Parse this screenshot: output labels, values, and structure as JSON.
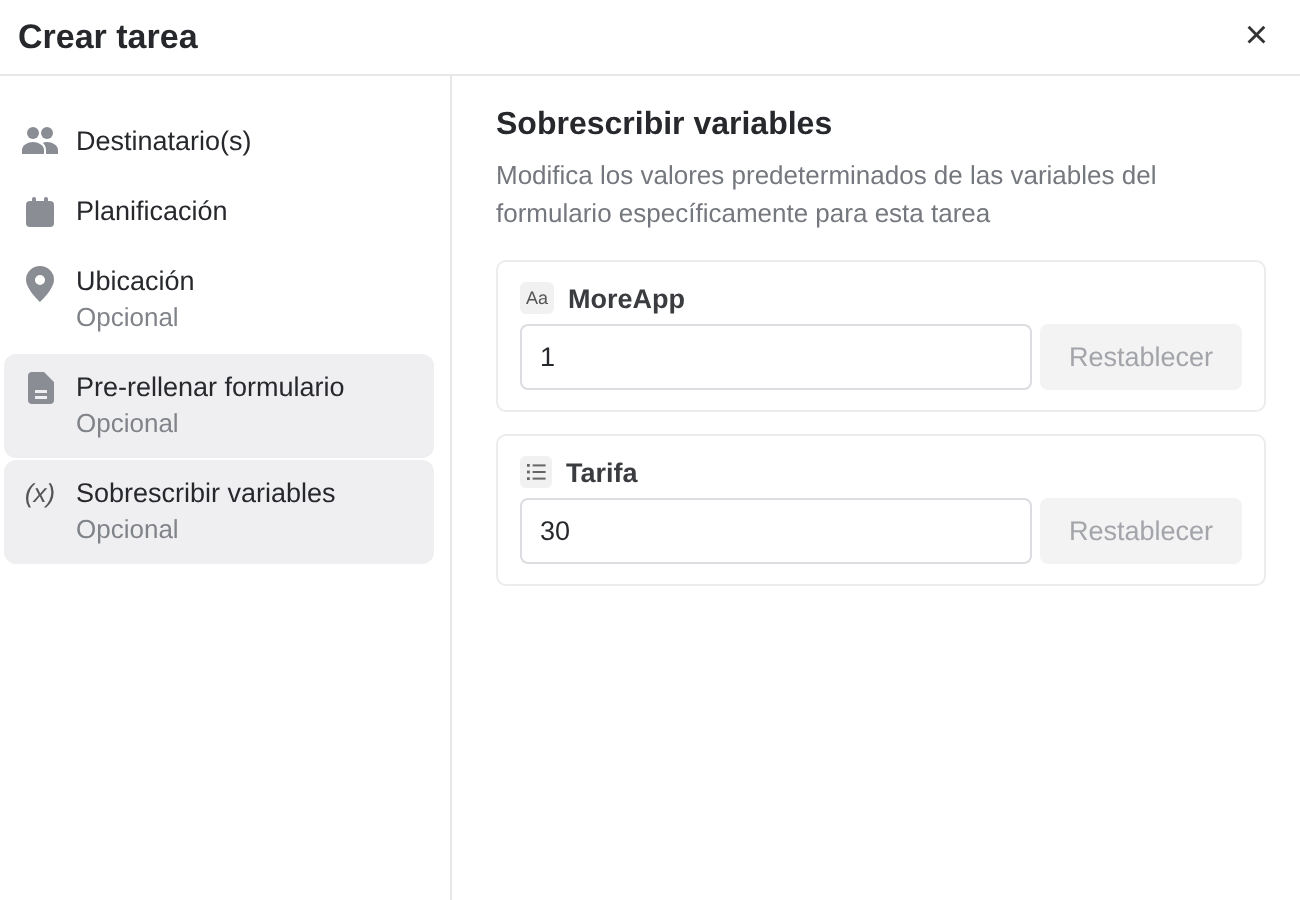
{
  "window": {
    "title": "Crear tarea",
    "close": "×"
  },
  "sidebar": {
    "items": [
      {
        "kind": "people",
        "label": "Destinatario(s)",
        "selected": false
      },
      {
        "kind": "calendar",
        "label": "Planificación",
        "selected": false
      },
      {
        "kind": "pin",
        "label": "Ubicación",
        "sublabel": "Opcional",
        "selected": false
      },
      {
        "kind": "document",
        "label": "Pre-rellenar formulario",
        "sublabel": "Opcional",
        "selected": true
      },
      {
        "kind": "variable",
        "icon_text": "(x)",
        "label": "Sobrescribir variables",
        "sublabel": "Opcional",
        "selected": true
      }
    ]
  },
  "panel": {
    "title": "Sobrescribir variables",
    "description": "Modifica los valores predeterminados de las variables del formulario específicamente para esta tarea",
    "variables": [
      {
        "kind": "text",
        "badge": "Aa",
        "name": "MoreApp",
        "value": "1",
        "button": {
          "label": "Restablecer",
          "disabled": true
        }
      },
      {
        "kind": "list",
        "name": "Tarifa",
        "value": "30",
        "button": {
          "label": "Restablecer",
          "disabled": true
        }
      }
    ]
  }
}
